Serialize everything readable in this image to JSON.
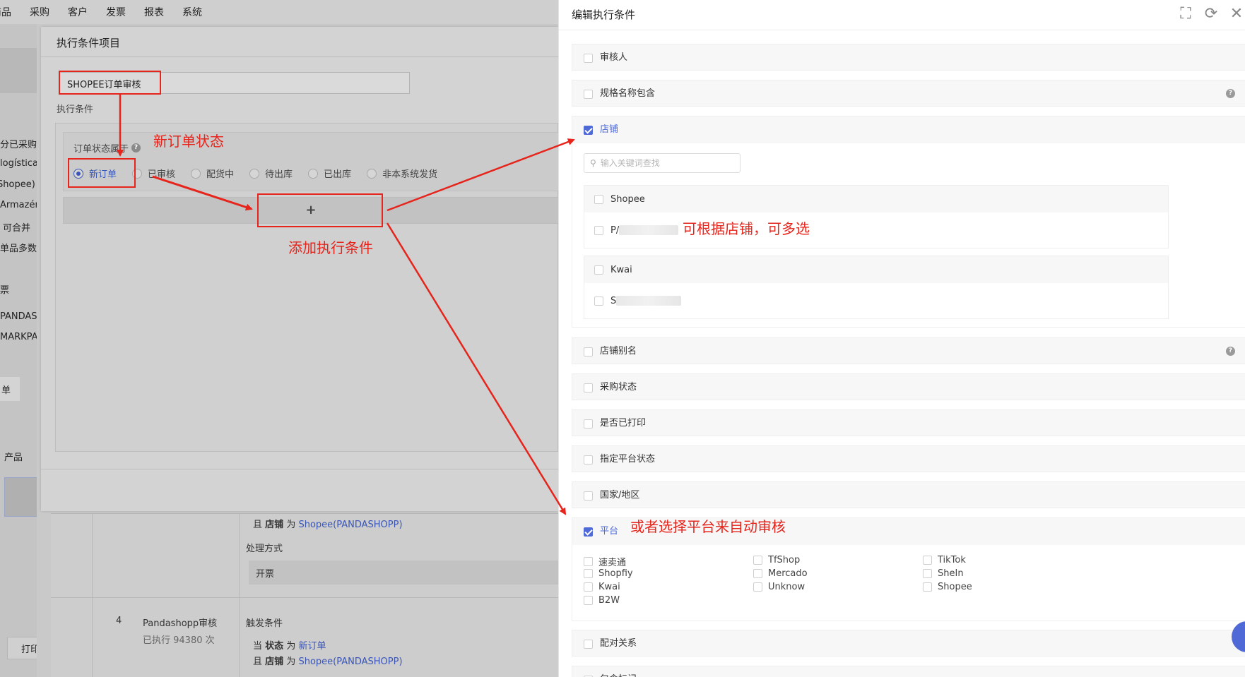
{
  "topnav": [
    "商品",
    "采购",
    "客户",
    "发票",
    "报表",
    "系统"
  ],
  "left_strip": [
    "分已采购",
    "logística (",
    "Shopee)",
    "Armazém",
    "可合并",
    "单品多数",
    "票",
    "PANDASHO",
    "MARKPAI",
    "单",
    "产品",
    "打印"
  ],
  "dialog": {
    "title": "执行条件项目",
    "name_value": "SHOPEE订单审核",
    "exec_label": "执行条件",
    "condition_title": "订单状态属于",
    "status_options": [
      "新订单",
      "已审核",
      "配货中",
      "待出库",
      "已出库",
      "非本系统发货"
    ],
    "selected_status": "新订单",
    "add_symbol": "+"
  },
  "bg_table": {
    "row3_shop_line": {
      "prefix": "且",
      "field": "店铺",
      "op": "为",
      "value": "Shopee(PANDASHOPP)"
    },
    "process_label": "处理方式",
    "process_value": "开票",
    "row4": {
      "index": "4",
      "name": "Pandashopp审核",
      "executed": "已执行 94380 次",
      "trigger_label": "触发条件",
      "line1": {
        "prefix": "当",
        "field": "状态",
        "op": "为",
        "value": "新订单"
      },
      "line2": {
        "prefix": "且",
        "field": "店铺",
        "op": "为",
        "value": "Shopee(PANDASHOPP)"
      }
    }
  },
  "drawer": {
    "title": "编辑执行条件",
    "tools": {
      "fullscreen": "⛶",
      "refresh": "⟳",
      "close": "✕"
    },
    "sections": {
      "reviewer": "审核人",
      "spec_contains": "规格名称包含",
      "store": "店铺",
      "store_alias": "店铺别名",
      "purchase_status": "采购状态",
      "printed": "是否已打印",
      "platform_status": "指定平台状态",
      "country": "国家/地区",
      "platform": "平台",
      "pairing": "配对关系",
      "package_tag": "包含标记"
    },
    "search_placeholder": "输入关键词查找",
    "shop_groups": [
      {
        "name": "Shopee",
        "shops": [
          "P/"
        ]
      },
      {
        "name": "Kwai",
        "shops": [
          "S"
        ]
      }
    ],
    "platforms": [
      [
        "速卖通",
        "Shopfiy",
        "Kwai",
        "B2W"
      ],
      [
        "TfShop",
        "Mercado",
        "Unknow"
      ],
      [
        "TikTok",
        "SheIn",
        "Shopee"
      ]
    ]
  },
  "annotations": {
    "new_order_status": "新订单状态",
    "add_condition": "添加执行条件",
    "by_store": "可根据店铺，可多选",
    "by_platform": "或者选择平台来自动审核",
    "color": "#e6241b"
  }
}
